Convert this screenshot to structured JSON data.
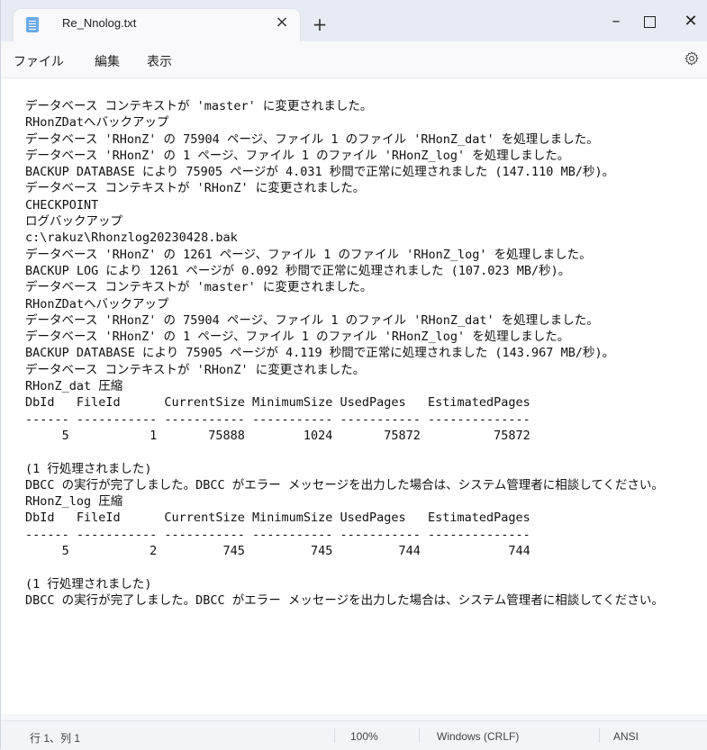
{
  "window": {
    "tab_title": "Re_Nnolog.txt",
    "tab_close": "×",
    "new_tab": "+",
    "minimize": "–",
    "close": "✕"
  },
  "menu": {
    "file": "ファイル",
    "edit": "編集",
    "view": "表示"
  },
  "settings_icon": "gear-icon",
  "document": {
    "lines": [
      "データベース コンテキストが 'master' に変更されました。",
      "RHonZDatへバックアップ",
      "データベース 'RHonZ' の 75904 ページ、ファイル 1 のファイル 'RHonZ_dat' を処理しました。",
      "データベース 'RHonZ' の 1 ページ、ファイル 1 のファイル 'RHonZ_log' を処理しました。",
      "BACKUP DATABASE により 75905 ページが 4.031 秒間で正常に処理されました (147.110 MB/秒)。",
      "データベース コンテキストが 'RHonZ' に変更されました。",
      "CHECKPOINT",
      "ログバックアップ",
      "c:\\rakuz\\Rhonzlog20230428.bak",
      "データベース 'RHonZ' の 1261 ページ、ファイル 1 のファイル 'RHonZ_log' を処理しました。",
      "BACKUP LOG により 1261 ページが 0.092 秒間で正常に処理されました (107.023 MB/秒)。",
      "データベース コンテキストが 'master' に変更されました。",
      "RHonZDatへバックアップ",
      "データベース 'RHonZ' の 75904 ページ、ファイル 1 のファイル 'RHonZ_dat' を処理しました。",
      "データベース 'RHonZ' の 1 ページ、ファイル 1 のファイル 'RHonZ_log' を処理しました。",
      "BACKUP DATABASE により 75905 ページが 4.119 秒間で正常に処理されました (143.967 MB/秒)。",
      "データベース コンテキストが 'RHonZ' に変更されました。",
      "RHonZ_dat 圧縮",
      "DbId   FileId      CurrentSize MinimumSize UsedPages   EstimatedPages",
      "------ ----------- ----------- ----------- ----------- --------------",
      "     5           1       75888        1024       75872          75872",
      "",
      "(1 行処理されました)",
      "DBCC の実行が完了しました。DBCC がエラー メッセージを出力した場合は、システム管理者に相談してください。",
      "RHonZ_log 圧縮",
      "DbId   FileId      CurrentSize MinimumSize UsedPages   EstimatedPages",
      "------ ----------- ----------- ----------- ----------- --------------",
      "     5           2         745         745         744            744",
      "",
      "(1 行処理されました)",
      "DBCC の実行が完了しました。DBCC がエラー メッセージを出力した場合は、システム管理者に相談してください。"
    ]
  },
  "status": {
    "position": "行 1、列 1",
    "zoom": "100%",
    "line_ending": "Windows (CRLF)",
    "encoding": "ANSI"
  }
}
